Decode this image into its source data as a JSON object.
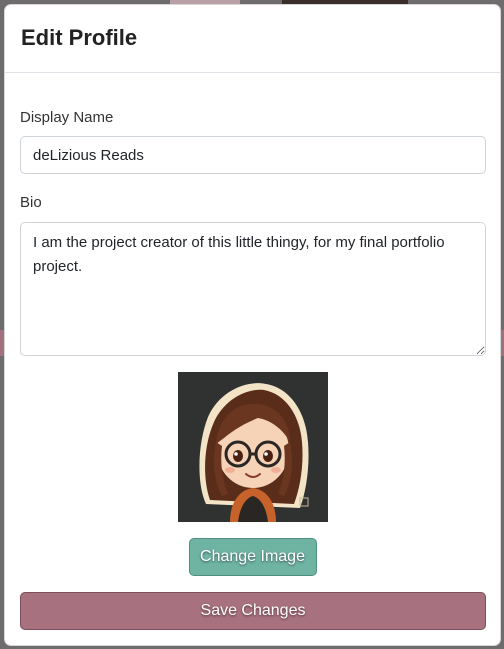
{
  "modal": {
    "title": "Edit Profile"
  },
  "form": {
    "display_name_label": "Display Name",
    "display_name_value": "deLizious Reads",
    "bio_label": "Bio",
    "bio_value": "I am the project creator of this little thingy, for my final portfolio project."
  },
  "avatar": {
    "description": "avatar-image",
    "background_color": "#2f3230"
  },
  "buttons": {
    "change_image_label": "Change Image",
    "save_changes_label": "Save Changes"
  },
  "colors": {
    "change_image_bg": "#6fb3a3",
    "save_changes_bg": "#a8717f"
  }
}
